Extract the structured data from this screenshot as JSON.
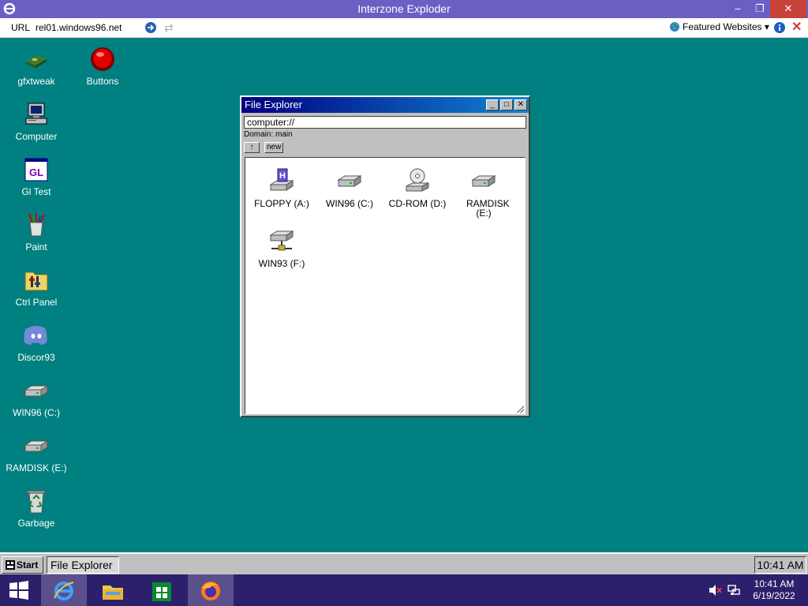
{
  "host": {
    "title": "Interzone Exploder",
    "minimize": "–",
    "restore": "❐",
    "close": "✕",
    "url_label": "URL",
    "url": "rel01.windows96.net",
    "featured": "Featured Websites",
    "featured_caret": "▾"
  },
  "desktop_icons": [
    {
      "label": "gfxtweak",
      "icon": "gfxtweak-icon"
    },
    {
      "label": "Buttons",
      "icon": "red-button-icon"
    },
    {
      "label": "Computer",
      "icon": "computer-icon"
    },
    {
      "label": "Gl Test",
      "icon": "gl-test-icon"
    },
    {
      "label": "Paint",
      "icon": "paint-icon"
    },
    {
      "label": "Ctrl Panel",
      "icon": "control-panel-icon"
    },
    {
      "label": "Discor93",
      "icon": "discord-icon"
    },
    {
      "label": "WIN96 (C:)",
      "icon": "hard-drive-icon"
    },
    {
      "label": "RAMDISK (E:)",
      "icon": "hard-drive-icon"
    },
    {
      "label": "Garbage",
      "icon": "recycle-bin-icon"
    }
  ],
  "explorer": {
    "title": "File Explorer",
    "address": "computer://",
    "domain": "Domain: main",
    "up_label": "↑",
    "new_label": "new",
    "drives": [
      {
        "label": "FLOPPY (A:)",
        "icon": "floppy-drive-icon"
      },
      {
        "label": "WIN96 (C:)",
        "icon": "hard-drive-icon"
      },
      {
        "label": "CD-ROM (D:)",
        "icon": "cd-rom-icon"
      },
      {
        "label": "RAMDISK (E:)",
        "icon": "hard-drive-icon"
      },
      {
        "label": "WIN93 (F:)",
        "icon": "network-drive-icon"
      }
    ]
  },
  "taskbar": {
    "start": "Start",
    "task": "File Explorer",
    "clock": "10:41 AM"
  },
  "host_taskbar": {
    "time": "10:41 AM",
    "date": "6/19/2022"
  },
  "colors": {
    "desktop": "#008080",
    "host_title": "#6b5fc4",
    "host_taskbar": "#2c1f6b",
    "window_title": "#000080"
  }
}
